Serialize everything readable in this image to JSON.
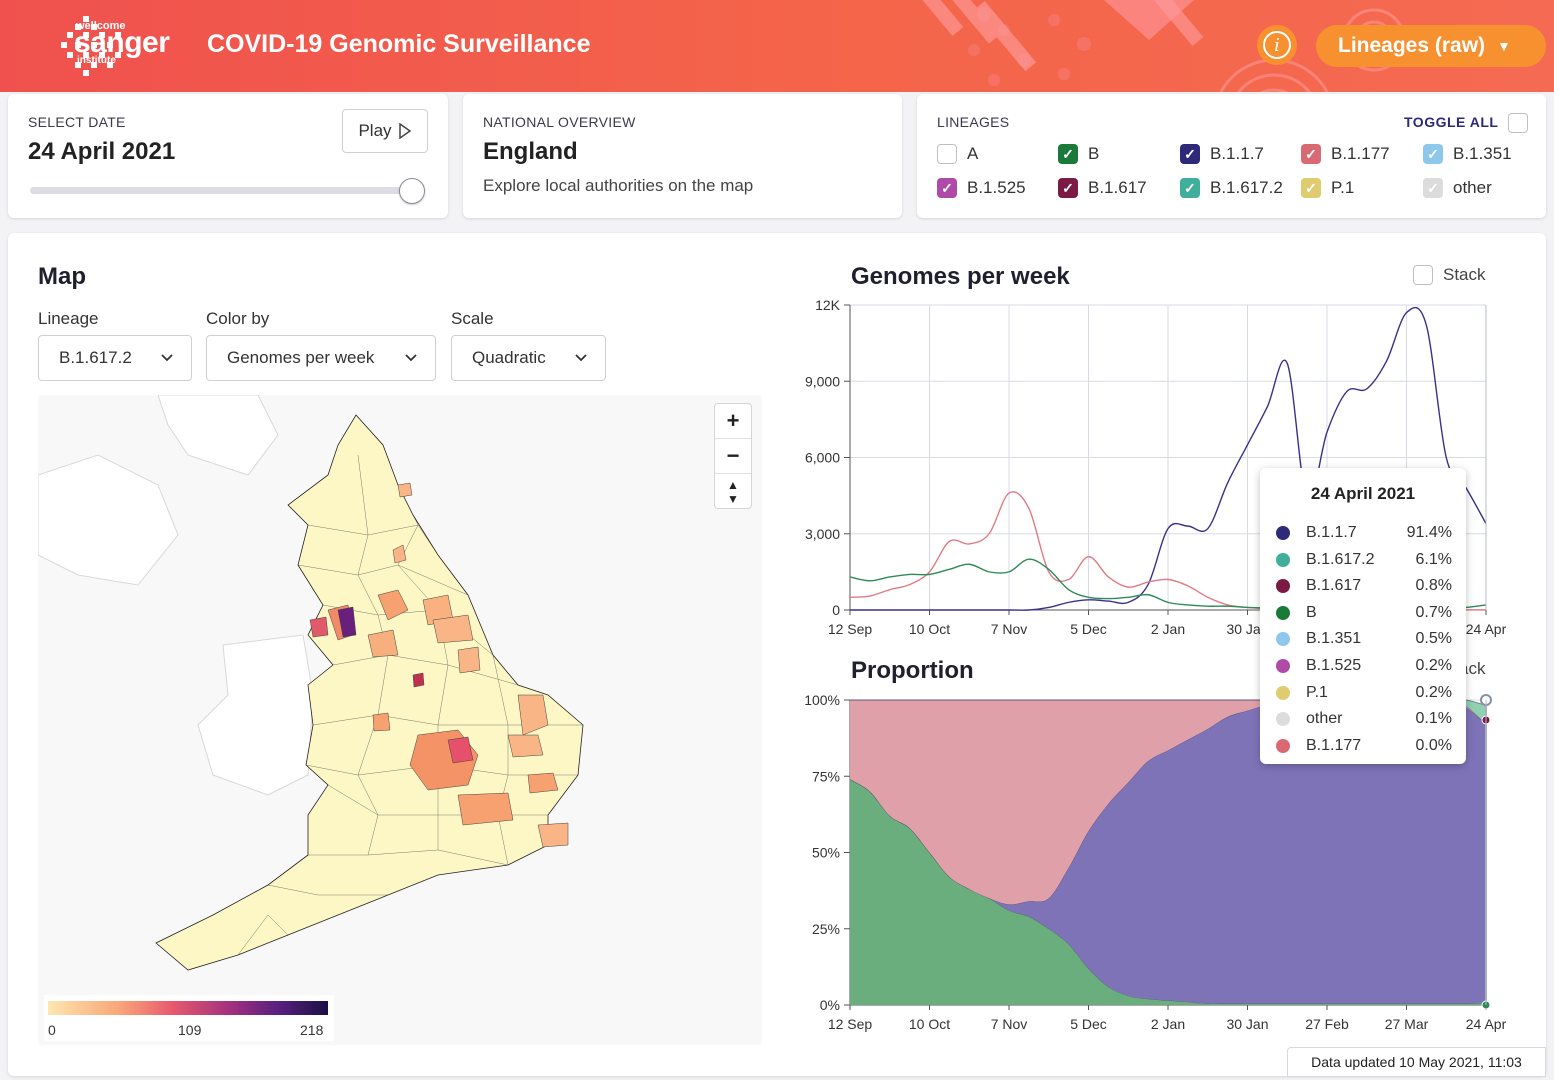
{
  "header": {
    "logo_line1": "wellcome",
    "logo_line2": "sanger",
    "logo_line3": "institute",
    "title": "COVID-19 Genomic Surveillance",
    "mode_label": "Lineages (raw)"
  },
  "date_card": {
    "label": "SELECT DATE",
    "value": "24 April 2021",
    "play_label": "Play"
  },
  "overview_card": {
    "label": "NATIONAL OVERVIEW",
    "region": "England",
    "hint": "Explore local authorities on the map"
  },
  "lineages_card": {
    "label": "LINEAGES",
    "toggle_all": "TOGGLE ALL",
    "items": [
      {
        "name": "A",
        "checked": false,
        "color": "#ffffff"
      },
      {
        "name": "B",
        "checked": true,
        "color": "#1a7a3a"
      },
      {
        "name": "B.1.1.7",
        "checked": true,
        "color": "#2e2a7a"
      },
      {
        "name": "B.1.177",
        "checked": true,
        "color": "#d96a74"
      },
      {
        "name": "B.1.351",
        "checked": true,
        "color": "#8dc8ec"
      },
      {
        "name": "B.1.525",
        "checked": true,
        "color": "#b04aa8"
      },
      {
        "name": "B.1.617",
        "checked": true,
        "color": "#7a1a45"
      },
      {
        "name": "B.1.617.2",
        "checked": true,
        "color": "#3fae9a"
      },
      {
        "name": "P.1",
        "checked": true,
        "color": "#e0cc70"
      },
      {
        "name": "other",
        "checked": true,
        "color": "#dcdcdc"
      }
    ]
  },
  "map_panel": {
    "title": "Map",
    "lineage_label": "Lineage",
    "lineage_value": "B.1.617.2",
    "color_label": "Color by",
    "color_value": "Genomes per week",
    "scale_label": "Scale",
    "scale_value": "Quadratic",
    "legend_min": "0",
    "legend_mid": "109",
    "legend_max": "218"
  },
  "chart_data": [
    {
      "type": "line",
      "title": "Genomes per week",
      "stack_label": "Stack",
      "stacked": false,
      "x_ticks": [
        "12 Sep",
        "10 Oct",
        "7 Nov",
        "5 Dec",
        "2 Jan",
        "30 Jan",
        "27 Feb",
        "27 Mar",
        "24 Apr"
      ],
      "y_ticks": [
        "0",
        "3,000",
        "6,000",
        "9,000",
        "12K"
      ],
      "ylim": [
        0,
        12000
      ],
      "x": [
        0,
        1,
        2,
        3,
        4,
        5,
        6,
        7,
        8,
        9,
        10,
        11,
        12,
        13,
        14,
        15,
        16,
        17,
        18,
        19,
        20,
        21,
        22,
        23,
        24,
        25,
        26,
        27,
        28,
        29,
        30,
        31,
        32
      ],
      "series": [
        {
          "color": "#3b2f8a",
          "values": [
            0,
            0,
            0,
            0,
            0,
            0,
            0,
            0,
            0,
            0,
            100,
            300,
            400,
            350,
            300,
            1000,
            3200,
            3300,
            3200,
            5000,
            6500,
            8000,
            9700,
            4300,
            7000,
            8600,
            8700,
            9800,
            11700,
            11200,
            6000,
            4800,
            3400
          ]
        },
        {
          "color": "#e07a86",
          "values": [
            500,
            550,
            800,
            1000,
            1500,
            2700,
            2600,
            3000,
            4600,
            4000,
            1500,
            1200,
            2100,
            1300,
            900,
            1100,
            1200,
            950,
            500,
            200,
            100,
            50,
            50,
            20,
            10,
            10,
            5,
            5,
            5,
            5,
            5,
            5,
            5
          ]
        },
        {
          "color": "#2e8b57",
          "values": [
            1300,
            1150,
            1300,
            1400,
            1400,
            1600,
            1800,
            1500,
            1500,
            2000,
            1600,
            800,
            500,
            450,
            500,
            600,
            300,
            200,
            150,
            150,
            100,
            80,
            50,
            40,
            30,
            20,
            20,
            20,
            20,
            20,
            50,
            100,
            200
          ]
        }
      ]
    },
    {
      "type": "area",
      "title": "Proportion",
      "stack_label": "Stack",
      "stacked": true,
      "x_ticks": [
        "12 Sep",
        "10 Oct",
        "7 Nov",
        "5 Dec",
        "2 Jan",
        "30 Jan",
        "27 Feb",
        "27 Mar",
        "24 Apr"
      ],
      "y_ticks": [
        "0%",
        "25%",
        "50%",
        "75%",
        "100%"
      ],
      "ylim": [
        0,
        100
      ],
      "x": [
        0,
        1,
        2,
        3,
        4,
        5,
        6,
        7,
        8,
        9,
        10,
        11,
        12,
        13,
        14,
        15,
        16,
        17,
        18,
        19,
        20,
        21,
        22,
        23,
        24,
        25,
        26,
        27,
        28,
        29,
        30,
        31,
        32
      ],
      "series": [
        {
          "color": "#6aae7e",
          "values": [
            74,
            70,
            62,
            58,
            50,
            42,
            38,
            35,
            31,
            29,
            25,
            20,
            12,
            6,
            3,
            2,
            1.5,
            1,
            0.5,
            0.5,
            0.5,
            0.5,
            0.5,
            0.5,
            0.5,
            0.5,
            0.5,
            0.5,
            0.5,
            0.5,
            0.5,
            0.5,
            0.7
          ]
        },
        {
          "color": "#7f73b8",
          "values": [
            0,
            0,
            0,
            0,
            0,
            0,
            0,
            0,
            2,
            5,
            10,
            25,
            45,
            60,
            70,
            78,
            82,
            86,
            90,
            94,
            96,
            98,
            99,
            99,
            99,
            99,
            99,
            99,
            99,
            99,
            99,
            97,
            91.4
          ]
        },
        {
          "color": "#e0a0aa",
          "values": [
            26,
            30,
            38,
            42,
            50,
            58,
            62,
            65,
            67,
            66,
            65,
            55,
            43,
            34,
            27,
            20,
            16.5,
            13,
            9.5,
            5.5,
            3.5,
            1.5,
            0.5,
            0.5,
            0.5,
            0.5,
            0.5,
            0.5,
            0.5,
            0.5,
            0.5,
            0.5,
            0
          ]
        },
        {
          "color": "#8fd0b0",
          "values": [
            0,
            0,
            0,
            0,
            0,
            0,
            0,
            0,
            0,
            0,
            0,
            0,
            0,
            0,
            0,
            0,
            0,
            0,
            0,
            0,
            0,
            0,
            0,
            0,
            0,
            0,
            0,
            0,
            0,
            0,
            0,
            2,
            6.1
          ]
        }
      ]
    }
  ],
  "tooltip": {
    "title": "24 April 2021",
    "rows": [
      {
        "name": "B.1.1.7",
        "value": "91.4%",
        "color": "#2e2a7a"
      },
      {
        "name": "B.1.617.2",
        "value": "6.1%",
        "color": "#3fae9a"
      },
      {
        "name": "B.1.617",
        "value": "0.8%",
        "color": "#7a1a45"
      },
      {
        "name": "B",
        "value": "0.7%",
        "color": "#1a7a3a"
      },
      {
        "name": "B.1.351",
        "value": "0.5%",
        "color": "#8dc8ec"
      },
      {
        "name": "B.1.525",
        "value": "0.2%",
        "color": "#b04aa8"
      },
      {
        "name": "P.1",
        "value": "0.2%",
        "color": "#e0cc70"
      },
      {
        "name": "other",
        "value": "0.1%",
        "color": "#dcdcdc"
      },
      {
        "name": "B.1.177",
        "value": "0.0%",
        "color": "#d96a74"
      }
    ]
  },
  "footer": {
    "updated": "Data updated 10 May 2021, 11:03"
  }
}
